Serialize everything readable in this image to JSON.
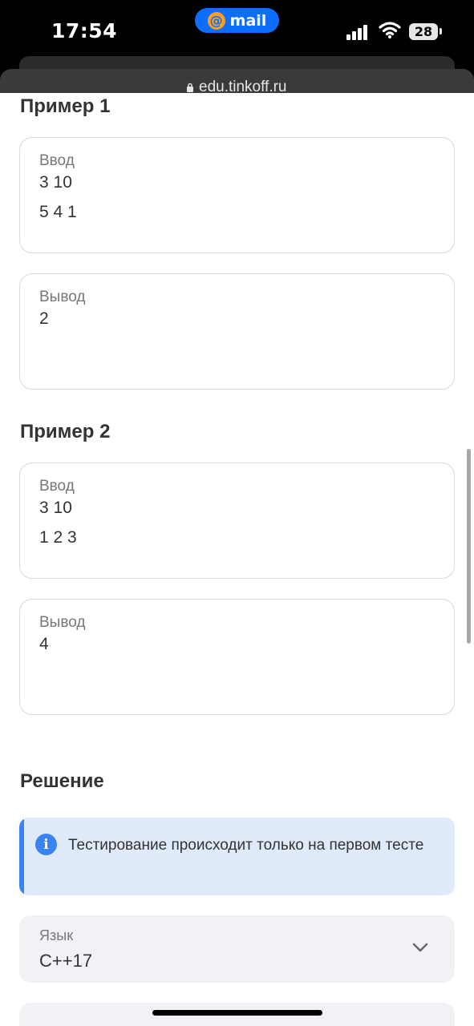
{
  "status_bar": {
    "time": "17:54",
    "mail_app_label": "mail",
    "battery_level": "28"
  },
  "browser": {
    "url": "edu.tinkoff.ru"
  },
  "examples": [
    {
      "title": "Пример 1",
      "input_label": "Ввод",
      "input_lines": [
        "3 10",
        "5 4 1"
      ],
      "output_label": "Вывод",
      "output_lines": [
        "2"
      ]
    },
    {
      "title": "Пример 2",
      "input_label": "Ввод",
      "input_lines": [
        "3 10",
        "1 2 3"
      ],
      "output_label": "Вывод",
      "output_lines": [
        "4"
      ]
    }
  ],
  "solution": {
    "title": "Решение",
    "info_text": "Тестирование происходит только на первом тесте",
    "language_label": "Язык",
    "language_value": "C++17"
  },
  "colors": {
    "accent": "#3a83f1",
    "info_bg": "#dfeafb",
    "mail_pill": "#0d6efd"
  },
  "icons": {
    "info": "info-icon",
    "dropdown": "chevron-down-icon",
    "lock": "lock-icon"
  }
}
